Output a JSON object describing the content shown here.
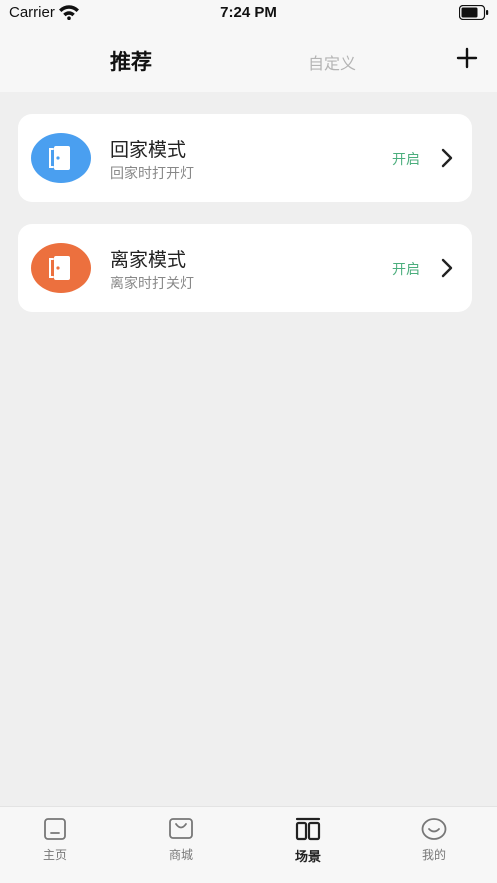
{
  "status_bar": {
    "carrier": "Carrier",
    "time": "7:24 PM"
  },
  "header": {
    "tab_recommend": "推荐",
    "tab_custom": "自定义"
  },
  "scenes": [
    {
      "title": "回家模式",
      "subtitle": "回家时打开灯",
      "state": "开启",
      "icon_color": "#4a9ff0",
      "icon": "door-icon"
    },
    {
      "title": "离家模式",
      "subtitle": "离家时打关灯",
      "state": "开启",
      "icon_color": "#ec703e",
      "icon": "door-icon"
    }
  ],
  "tabbar": {
    "items": [
      {
        "label": "主页",
        "icon": "home-icon"
      },
      {
        "label": "商城",
        "icon": "shop-bag-icon"
      },
      {
        "label": "场景",
        "icon": "scene-icon",
        "active": true
      },
      {
        "label": "我的",
        "icon": "smile-icon"
      }
    ]
  },
  "colors": {
    "accent_on": "#4cae7d",
    "background": "#efefef"
  }
}
